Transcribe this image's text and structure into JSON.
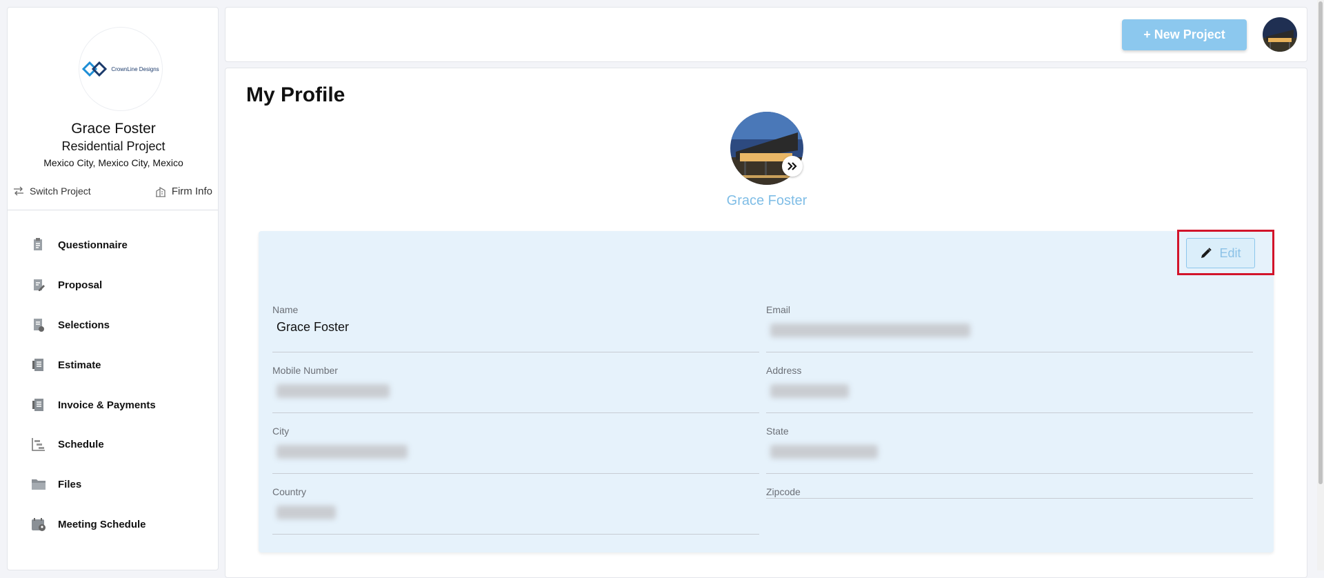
{
  "sidebar": {
    "logo_text": "CrownLine Designs",
    "user_name": "Grace Foster",
    "project_name": "Residential Project",
    "location": "Mexico City, Mexico City, Mexico",
    "switch_project_label": "Switch Project",
    "firm_info_label": "Firm Info",
    "nav_items": [
      {
        "label": "Questionnaire",
        "icon": "questionnaire-icon"
      },
      {
        "label": "Proposal",
        "icon": "proposal-icon"
      },
      {
        "label": "Selections",
        "icon": "selections-icon"
      },
      {
        "label": "Estimate",
        "icon": "estimate-icon"
      },
      {
        "label": "Invoice & Payments",
        "icon": "invoice-icon"
      },
      {
        "label": "Schedule",
        "icon": "schedule-icon"
      },
      {
        "label": "Files",
        "icon": "folder-icon"
      },
      {
        "label": "Meeting Schedule",
        "icon": "calendar-icon"
      }
    ]
  },
  "topbar": {
    "new_project_label": "+ New Project"
  },
  "profile": {
    "page_title": "My Profile",
    "name": "Grace Foster",
    "edit_label": "Edit",
    "fields": {
      "name_label": "Name",
      "name_value": "Grace Foster",
      "email_label": "Email",
      "mobile_label": "Mobile Number",
      "address_label": "Address",
      "city_label": "City",
      "state_label": "State",
      "country_label": "Country",
      "zipcode_label": "Zipcode"
    }
  },
  "colors": {
    "accent": "#8cc8ee",
    "card_bg": "#e6f2fb",
    "highlight": "#d2142a"
  }
}
